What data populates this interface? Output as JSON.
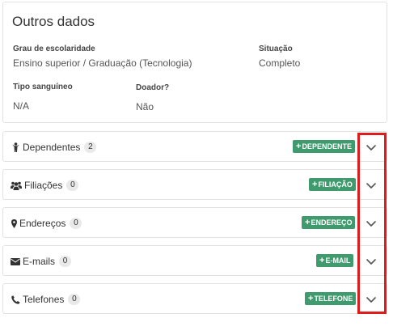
{
  "info": {
    "title": "Outros dados",
    "fields": [
      {
        "label": "Grau de escolaridade",
        "value": "Ensino superior / Graduação (Tecnologia)"
      },
      {
        "label": "Situação",
        "value": "Completo"
      },
      {
        "label": "Tipo sanguíneo",
        "value": "N/A"
      },
      {
        "label": "Doador?",
        "value": "Não"
      }
    ]
  },
  "sections": [
    {
      "title": "Dependentes",
      "count": "2",
      "button": "DEPENDENTE",
      "icon": "child-icon"
    },
    {
      "title": "Filiações",
      "count": "0",
      "button": "FILIAÇÃO",
      "icon": "users-icon"
    },
    {
      "title": "Endereços",
      "count": "0",
      "button": "ENDEREÇO",
      "icon": "map-marker-icon"
    },
    {
      "title": "E-mails",
      "count": "0",
      "button": "E-MAIL",
      "icon": "envelope-icon"
    },
    {
      "title": "Telefones",
      "count": "0",
      "button": "TELEFONE",
      "icon": "phone-icon"
    }
  ],
  "colors": {
    "button_green": "#3f9b6e",
    "highlight_red": "#e01b1b",
    "badge_gray": "#e9e9e9"
  },
  "icons": {
    "plus": "+",
    "expand": "chevron-down-icon"
  }
}
